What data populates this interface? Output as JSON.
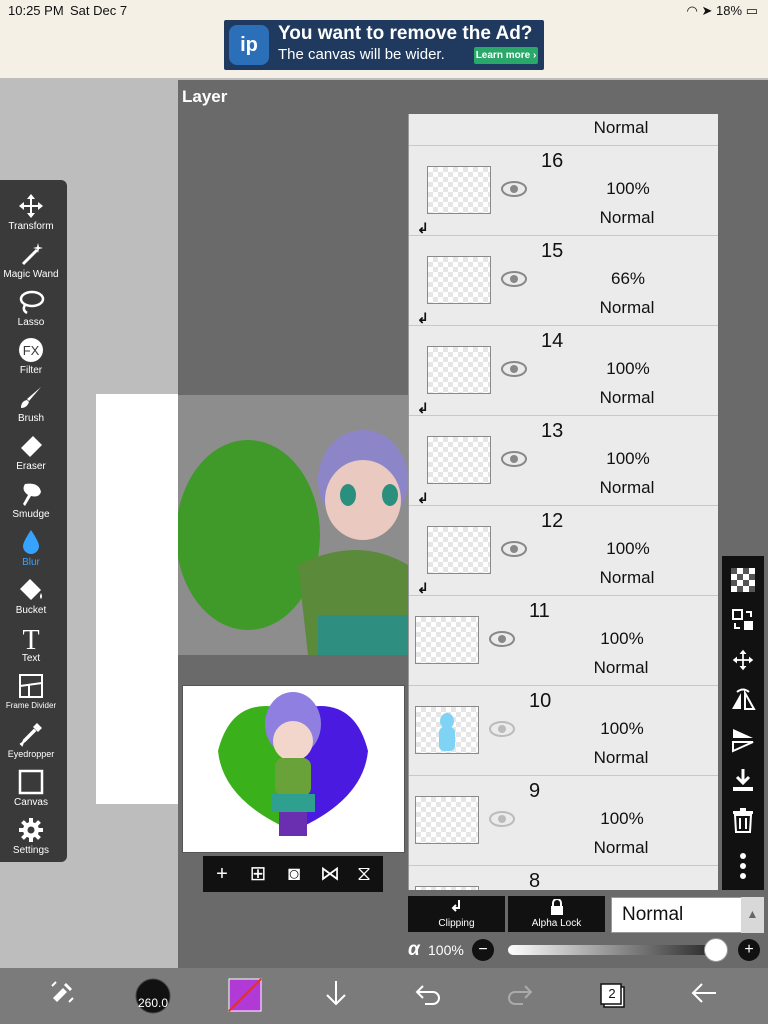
{
  "status": {
    "time": "10:25 PM",
    "date": "Sat Dec 7",
    "battery": "18%"
  },
  "ad": {
    "title": "You want to remove the Ad?",
    "subtitle": "The canvas will be wider.",
    "button": "Learn more ›",
    "logo": "ip"
  },
  "tools": [
    {
      "label": "Transform",
      "icon": "move-icon"
    },
    {
      "label": "Magic Wand",
      "icon": "magic-wand-icon"
    },
    {
      "label": "Lasso",
      "icon": "lasso-icon"
    },
    {
      "label": "Filter",
      "icon": "fx-icon"
    },
    {
      "label": "Brush",
      "icon": "brush-icon"
    },
    {
      "label": "Eraser",
      "icon": "eraser-icon"
    },
    {
      "label": "Smudge",
      "icon": "smudge-icon"
    },
    {
      "label": "Blur",
      "icon": "blur-drop-icon"
    },
    {
      "label": "Bucket",
      "icon": "bucket-icon"
    },
    {
      "label": "Text",
      "icon": "text-icon"
    },
    {
      "label": "Frame Divider",
      "icon": "frame-divider-icon"
    },
    {
      "label": "Eyedropper",
      "icon": "eyedropper-icon"
    },
    {
      "label": "Canvas",
      "icon": "canvas-icon"
    },
    {
      "label": "Settings",
      "icon": "gear-icon"
    }
  ],
  "active_tool": "Blur",
  "layer_panel": {
    "title": "Layer",
    "top_partial_blend": "Normal",
    "layers": [
      {
        "number": "16",
        "opacity": "100%",
        "blend": "Normal",
        "clipped": true,
        "visible": true
      },
      {
        "number": "15",
        "opacity": "66%",
        "blend": "Normal",
        "clipped": true,
        "visible": true
      },
      {
        "number": "14",
        "opacity": "100%",
        "blend": "Normal",
        "clipped": true,
        "visible": true
      },
      {
        "number": "13",
        "opacity": "100%",
        "blend": "Normal",
        "clipped": true,
        "visible": true
      },
      {
        "number": "12",
        "opacity": "100%",
        "blend": "Normal",
        "clipped": true,
        "visible": true
      },
      {
        "number": "11",
        "opacity": "100%",
        "blend": "Normal",
        "clipped": false,
        "visible": true
      },
      {
        "number": "10",
        "opacity": "100%",
        "blend": "Normal",
        "clipped": false,
        "visible": false
      },
      {
        "number": "9",
        "opacity": "100%",
        "blend": "Normal",
        "clipped": false,
        "visible": false
      }
    ],
    "partial_bottom_number": "8",
    "clipping_label": "Clipping",
    "alpha_lock_label": "Alpha Lock",
    "blend_mode": "Normal",
    "alpha_symbol": "α",
    "alpha_value": "100%",
    "alpha_fraction": 1.0
  },
  "bottom_bar": {
    "brush_size": "260.0",
    "layer_count": "2",
    "primary_color": "#b13ad6"
  },
  "colors": {
    "active_tool": "#35a3ff",
    "toolbar": "#3a3a3a",
    "panel": "#6a6a6a"
  }
}
